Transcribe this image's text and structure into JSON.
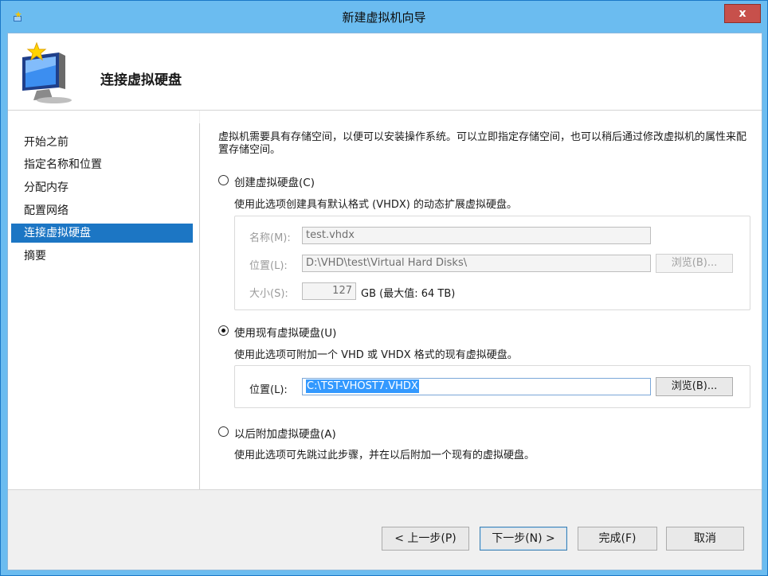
{
  "window": {
    "title": "新建虚拟机向导",
    "close_label": "x"
  },
  "header": {
    "title": "连接虚拟硬盘",
    "icon": "monitor-wizard-icon"
  },
  "nav": {
    "items": [
      {
        "label": "开始之前",
        "selected": false
      },
      {
        "label": "指定名称和位置",
        "selected": false
      },
      {
        "label": "分配内存",
        "selected": false
      },
      {
        "label": "配置网络",
        "selected": false
      },
      {
        "label": "连接虚拟硬盘",
        "selected": true
      },
      {
        "label": "摘要",
        "selected": false
      }
    ]
  },
  "content": {
    "intro": "虚拟机需要具有存储空间，以便可以安装操作系统。可以立即指定存储空间，也可以稍后通过修改虚拟机的属性来配置存储空间。",
    "create": {
      "label": "创建虚拟硬盘(C)",
      "desc": "使用此选项创建具有默认格式 (VHDX) 的动态扩展虚拟硬盘。",
      "selected": false,
      "name_label": "名称(M):",
      "name_value": "test.vhdx",
      "location_label": "位置(L):",
      "location_value": "D:\\VHD\\test\\Virtual Hard Disks\\",
      "browse_label": "浏览(B)...",
      "size_label": "大小(S):",
      "size_value": "127",
      "size_unit": "GB (最大值: 64 TB)"
    },
    "existing": {
      "label": "使用现有虚拟硬盘(U)",
      "desc": "使用此选项可附加一个 VHD 或 VHDX 格式的现有虚拟硬盘。",
      "selected": true,
      "location_label": "位置(L):",
      "location_value": "C:\\TST-VHOST7.VHDX",
      "browse_label": "浏览(B)..."
    },
    "later": {
      "label": "以后附加虚拟硬盘(A)",
      "desc": "使用此选项可先跳过此步骤，并在以后附加一个现有的虚拟硬盘。",
      "selected": false
    }
  },
  "footer": {
    "prev_label": "< 上一步(P)",
    "next_label": "下一步(N) >",
    "finish_label": "完成(F)",
    "cancel_label": "取消"
  },
  "colors": {
    "titlebar": "#6bbcf0",
    "selection": "#1c76c4",
    "close": "#c7504b"
  }
}
